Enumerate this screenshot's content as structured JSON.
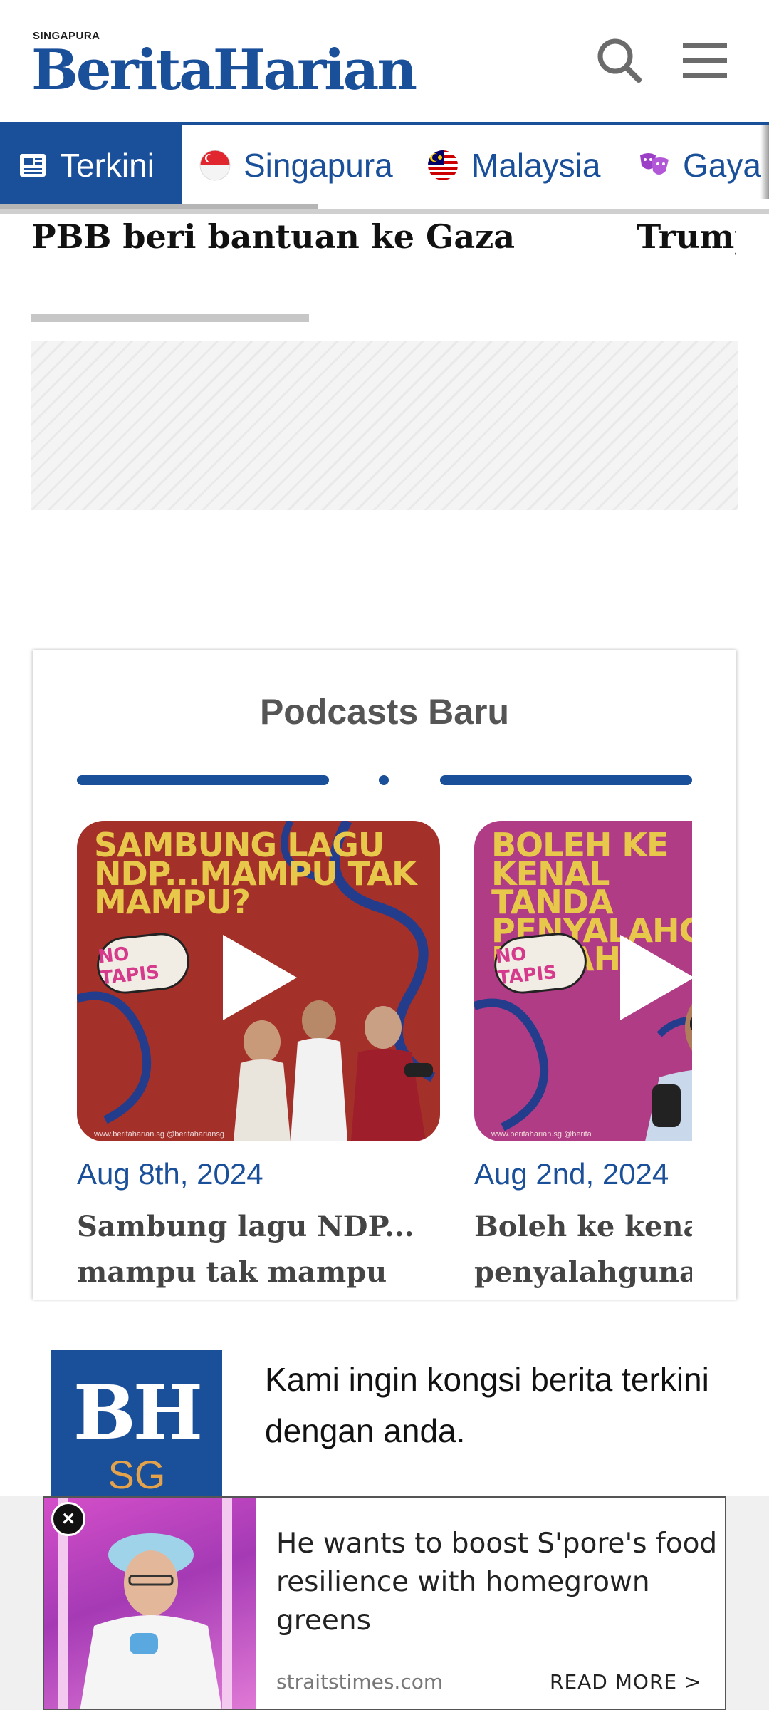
{
  "header": {
    "logo_small": "SINGAPURA",
    "logo_main": "BeritaHarian"
  },
  "nav": {
    "tabs": [
      {
        "label": "Terkini",
        "icon": "newspaper-icon",
        "active": true
      },
      {
        "label": "Singapura",
        "icon": "singapore-flag-icon",
        "active": false
      },
      {
        "label": "Malaysia",
        "icon": "malaysia-flag-icon",
        "active": false
      },
      {
        "label": "Gaya",
        "icon": "theater-masks-icon",
        "active": false
      }
    ]
  },
  "ticker": {
    "headlines": [
      "PBB beri bantuan ke Gaza",
      "Trump"
    ]
  },
  "podcasts": {
    "title": "Podcasts Baru",
    "items": [
      {
        "thumb_text": "SAMBUNG LAGU NDP...MAMPU TAK MAMPU?",
        "badge": "NO TAPIS",
        "footer": "www.beritaharian.sg   @beritahariansg",
        "date": "Aug 8th, 2024",
        "desc_line1": "Sambung lagu NDP...",
        "desc_line2": "mampu tak mampu"
      },
      {
        "thumb_text": "BOLEH KE KENAL TANDA PENYALAHGUNA DADAH?",
        "badge": "NO TAPIS",
        "footer": "www.beritaharian.sg   @berita",
        "date": "Aug 2nd, 2024",
        "desc_line1": "Boleh ke kenal tanda",
        "desc_line2": "penyalahgunaan"
      }
    ]
  },
  "promo": {
    "logo_letters": "BH",
    "logo_sub": "SG",
    "text": "Kami ingin kongsi berita terkini dengan anda."
  },
  "ad": {
    "headline": "He wants to boost S'pore's food resilience with homegrown greens",
    "source": "straitstimes.com",
    "cta": "READ MORE >",
    "close": "×"
  },
  "colors": {
    "brand_blue": "#1a4f9a",
    "thumb1_bg": "#a3312a",
    "thumb2_bg": "#b13c86",
    "thumb_text": "#e8c84a"
  }
}
